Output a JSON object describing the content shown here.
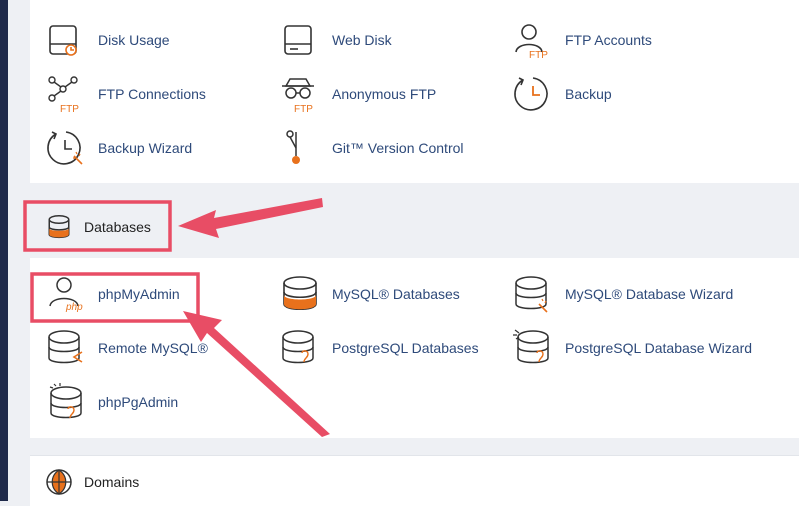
{
  "files": {
    "items": [
      {
        "label": "Disk Usage",
        "icon": "disk-usage-icon"
      },
      {
        "label": "Web Disk",
        "icon": "web-disk-icon"
      },
      {
        "label": "FTP Accounts",
        "icon": "ftp-accounts-icon"
      },
      {
        "label": "FTP Connections",
        "icon": "ftp-connections-icon"
      },
      {
        "label": "Anonymous FTP",
        "icon": "anonymous-ftp-icon"
      },
      {
        "label": "Backup",
        "icon": "backup-icon"
      },
      {
        "label": "Backup Wizard",
        "icon": "backup-wizard-icon"
      },
      {
        "label": "Git™ Version Control",
        "icon": "git-icon"
      }
    ]
  },
  "databases": {
    "title": "Databases",
    "items": [
      {
        "label": "phpMyAdmin",
        "icon": "phpmyadmin-icon"
      },
      {
        "label": "MySQL® Databases",
        "icon": "mysql-databases-icon"
      },
      {
        "label": "MySQL® Database Wizard",
        "icon": "mysql-wizard-icon"
      },
      {
        "label": "Remote MySQL®",
        "icon": "remote-mysql-icon"
      },
      {
        "label": "PostgreSQL Databases",
        "icon": "postgresql-databases-icon"
      },
      {
        "label": "PostgreSQL Database Wizard",
        "icon": "postgresql-wizard-icon"
      },
      {
        "label": "phpPgAdmin",
        "icon": "phppgadmin-icon"
      }
    ]
  },
  "domains": {
    "title": "Domains"
  },
  "ftp_badge": "FTP",
  "php_badge": "php",
  "colors": {
    "accent": "#e8711c",
    "icon_stroke": "#333333",
    "link": "#2e4a7a",
    "highlight": "#e84d65",
    "background": "#eef0f4",
    "rail": "#1f2a4a"
  }
}
